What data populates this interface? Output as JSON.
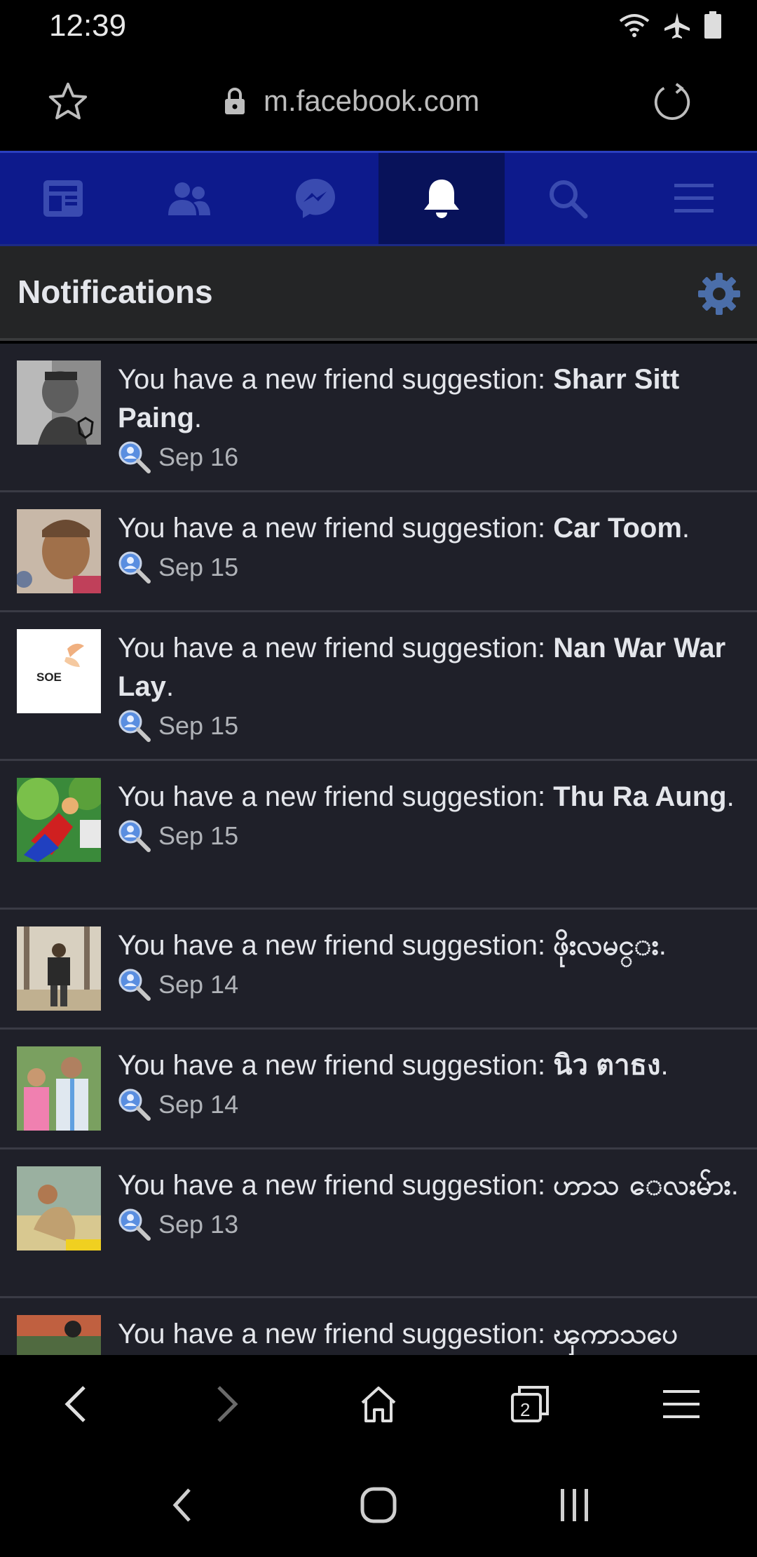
{
  "status": {
    "time": "12:39"
  },
  "browser": {
    "url": "m.facebook.com"
  },
  "fb_nav": {
    "active": "notifications"
  },
  "notifications": {
    "title": "Notifications",
    "items": [
      {
        "prefix": "You have a new friend suggestion: ",
        "name": "Sharr Sitt Paing",
        "suffix": ".",
        "date": "Sep 16"
      },
      {
        "prefix": "You have a new friend suggestion: ",
        "name": "Car Toom",
        "suffix": ".",
        "date": "Sep 15"
      },
      {
        "prefix": "You have a new friend suggestion: ",
        "name": "Nan War War Lay",
        "suffix": ".",
        "date": "Sep 15",
        "avatar_text": "SOE"
      },
      {
        "prefix": "You have a new friend suggestion: ",
        "name": "Thu Ra Aung",
        "suffix": ".",
        "date": "Sep 15"
      },
      {
        "prefix": "You have a new friend suggestion: ",
        "name": "ဖိုးလမင္း",
        "suffix": ".",
        "date": "Sep 14"
      },
      {
        "prefix": "You have a new friend suggestion: ",
        "name": "นิว ตาธง",
        "suffix": ".",
        "date": "Sep 14"
      },
      {
        "prefix": "You have a new friend suggestion: ",
        "name": "ဟာသ ေလးမ်ား",
        "suffix": ".",
        "date": "Sep 13"
      },
      {
        "prefix": "You have a new friend suggestion: ",
        "name": "ၾကာသပေ",
        "suffix": "",
        "date": ""
      }
    ]
  }
}
